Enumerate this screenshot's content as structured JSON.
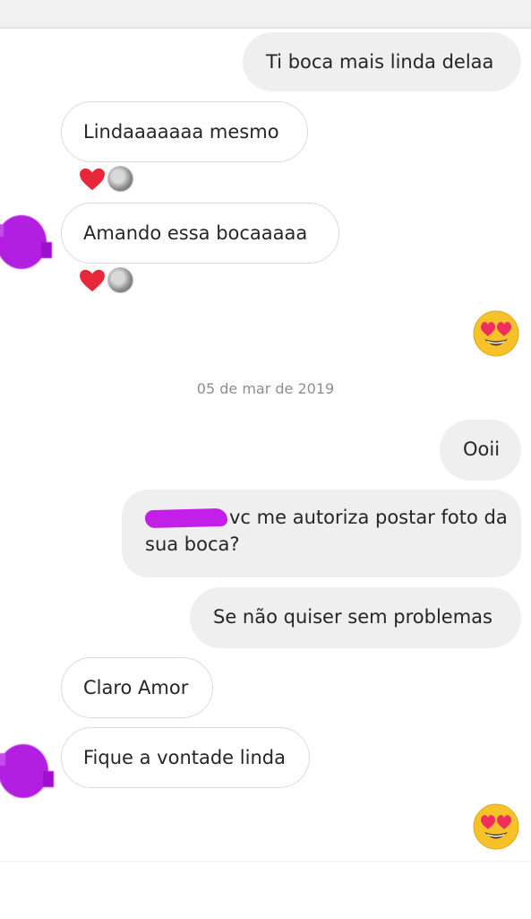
{
  "messages": {
    "m1": "Ti boca mais linda delaa",
    "m2": "Lindaaaaaaa mesmo",
    "m3": "Amando essa bocaaaaa",
    "date_separator": "05 de mar de 2019",
    "m4": "Ooii",
    "m5_line1": "vc me autoriza postar foto da",
    "m5_line2": "sua boca?",
    "m6": "Se não quiser sem problemas",
    "m7": "Claro Amor",
    "m8": "Fique a vontade linda"
  },
  "icons": {
    "reaction_heart": "heart-icon",
    "reaction_avatar": "reactor-avatar",
    "heart_eyes": "heart-eyes-emoji"
  },
  "colors": {
    "outgoing_bubble": "#efefef",
    "incoming_border": "#dbdbdb",
    "heart": "#e8283a",
    "redaction": "#c21fe8"
  }
}
